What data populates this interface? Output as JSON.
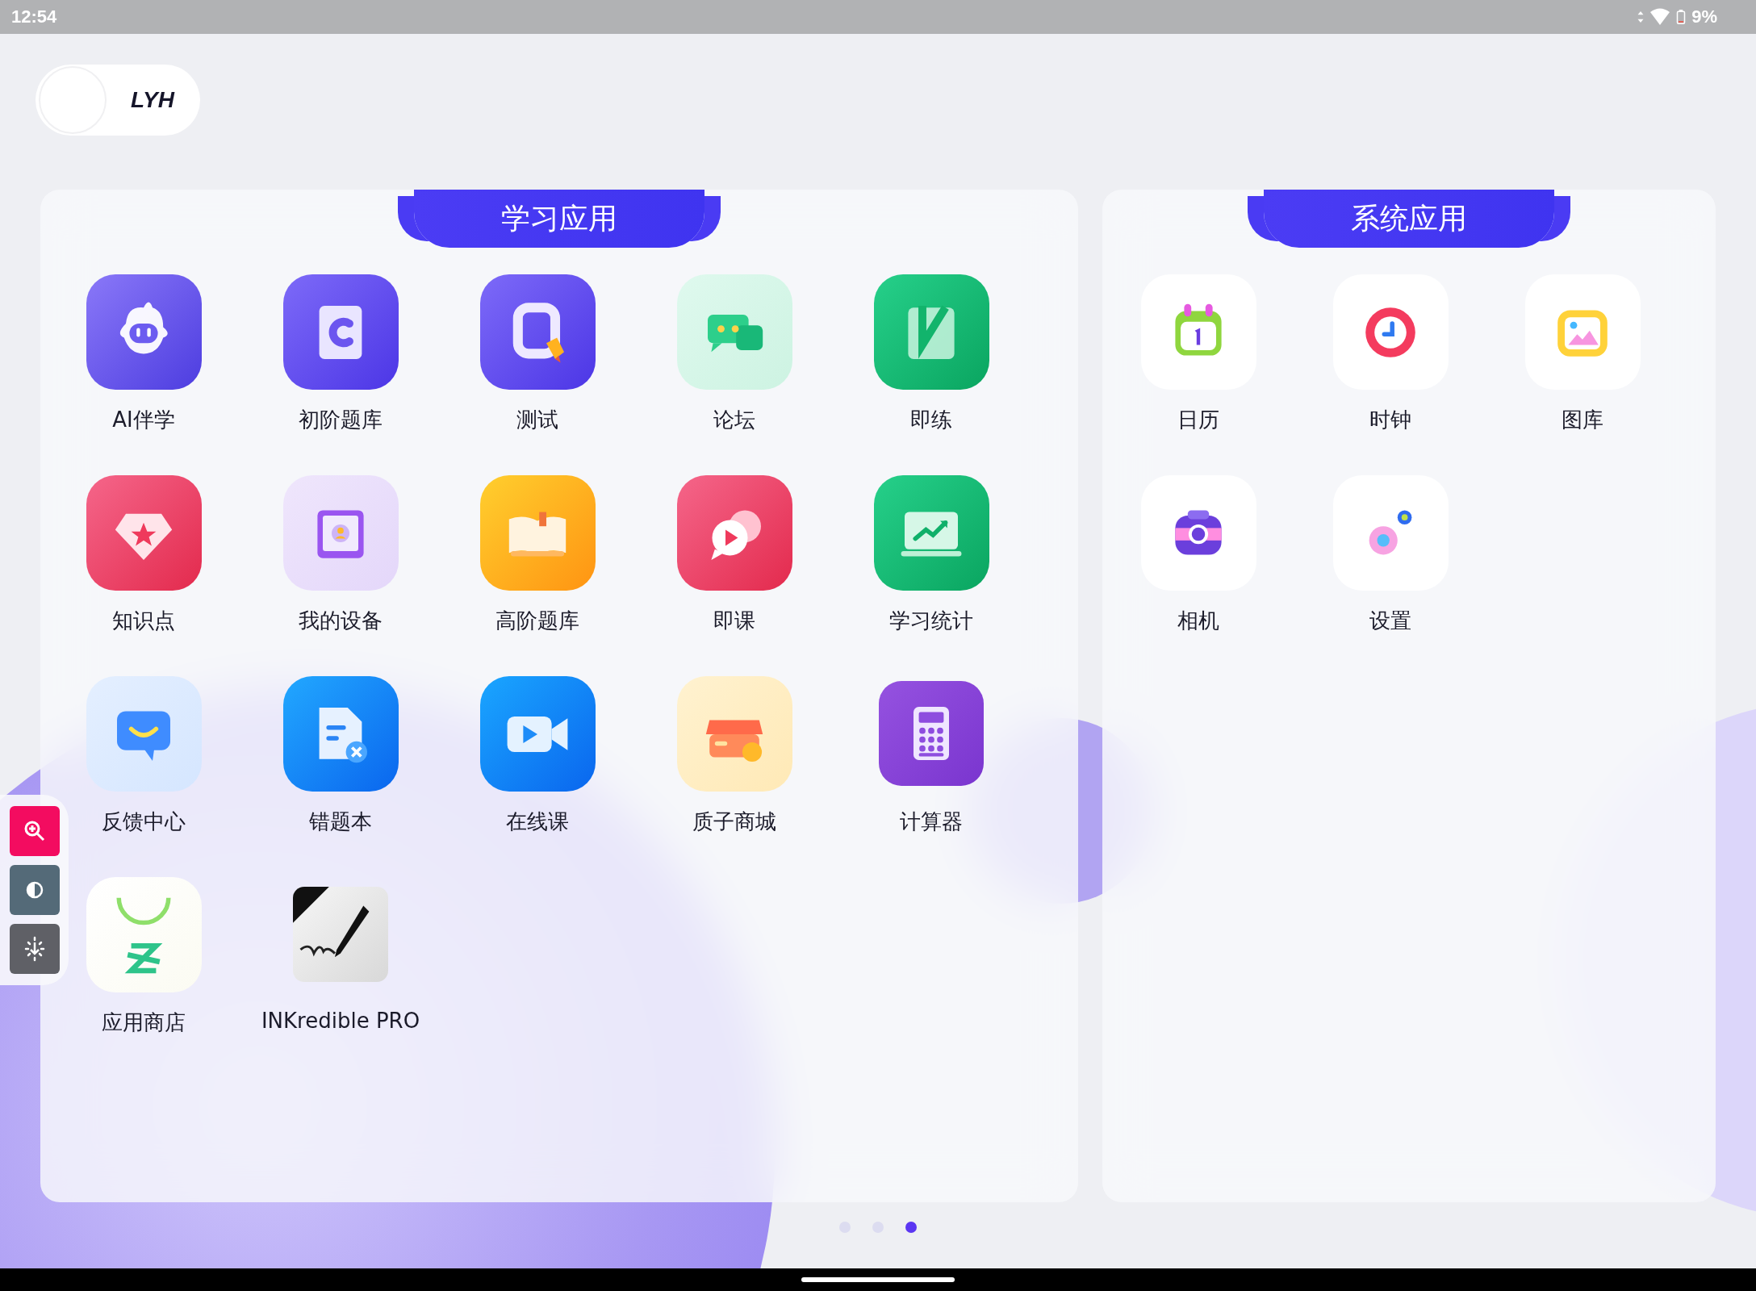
{
  "status_bar": {
    "time": "12:54",
    "battery": "9%"
  },
  "profile": {
    "name": "LYH"
  },
  "sections": [
    {
      "title": "学习应用",
      "apps": [
        {
          "label": "AI伴学"
        },
        {
          "label": "初阶题库"
        },
        {
          "label": "测试"
        },
        {
          "label": "论坛"
        },
        {
          "label": "即练"
        },
        {
          "label": "知识点"
        },
        {
          "label": "我的设备"
        },
        {
          "label": "高阶题库"
        },
        {
          "label": "即课"
        },
        {
          "label": "学习统计"
        },
        {
          "label": "反馈中心"
        },
        {
          "label": "错题本"
        },
        {
          "label": "在线课"
        },
        {
          "label": "质子商城"
        },
        {
          "label": "计算器"
        },
        {
          "label": "应用商店"
        },
        {
          "label": "INKredible PRO"
        }
      ]
    },
    {
      "title": "系统应用",
      "apps": [
        {
          "label": "日历"
        },
        {
          "label": "时钟"
        },
        {
          "label": "图库"
        },
        {
          "label": "相机"
        },
        {
          "label": "设置"
        }
      ]
    }
  ],
  "page_indicator": [
    {
      "selected": false
    },
    {
      "selected": false
    },
    {
      "selected": true
    }
  ]
}
